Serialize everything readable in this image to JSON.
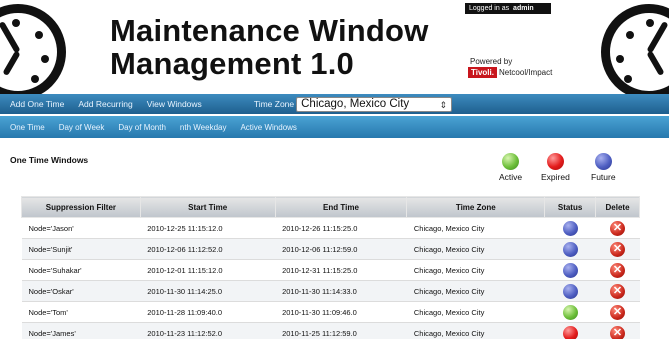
{
  "header": {
    "title_line1": "Maintenance Window",
    "title_line2": "Management 1.0",
    "logged_in_text": "Logged in as",
    "username": "admin",
    "powered_by": "Powered by",
    "brand": "Tivoli.",
    "product": "Netcool/Impact"
  },
  "nav_primary": {
    "items": [
      "Add One Time",
      "Add Recurring",
      "View Windows"
    ],
    "timezone_label": "Time Zone",
    "timezone_value": "Chicago, Mexico City"
  },
  "nav_secondary": {
    "items": [
      "One Time",
      "Day of Week",
      "Day of Month",
      "nth Weekday",
      "Active Windows"
    ]
  },
  "section": {
    "title": "One Time Windows"
  },
  "legend": [
    {
      "label": "Active",
      "color": "#6dbf3a"
    },
    {
      "label": "Expired",
      "color": "#e31b1b"
    },
    {
      "label": "Future",
      "color": "#4f5fc2"
    }
  ],
  "table": {
    "columns": [
      "Suppression Filter",
      "Start Time",
      "End Time",
      "Time Zone",
      "Status",
      "Delete"
    ],
    "rows": [
      {
        "filter": "Node='Jason'",
        "start": "2010-12-25 11:15:12.0",
        "end": "2010-12-26 11:15:25.0",
        "tz": "Chicago, Mexico City",
        "status": "future"
      },
      {
        "filter": "Node='Sunjit'",
        "start": "2010-12-06 11:12:52.0",
        "end": "2010-12-06 11:12:59.0",
        "tz": "Chicago, Mexico City",
        "status": "future"
      },
      {
        "filter": "Node='Suhakar'",
        "start": "2010-12-01 11:15:12.0",
        "end": "2010-12-31 11:15:25.0",
        "tz": "Chicago, Mexico City",
        "status": "future"
      },
      {
        "filter": "Node='Oskar'",
        "start": "2010-11-30 11:14:25.0",
        "end": "2010-11-30 11:14:33.0",
        "tz": "Chicago, Mexico City",
        "status": "future"
      },
      {
        "filter": "Node='Tom'",
        "start": "2010-11-28 11:09:40.0",
        "end": "2010-11-30 11:09:46.0",
        "tz": "Chicago, Mexico City",
        "status": "active"
      },
      {
        "filter": "Node='James'",
        "start": "2010-11-23 11:12:52.0",
        "end": "2010-11-25 11:12:59.0",
        "tz": "Chicago, Mexico City",
        "status": "expired"
      }
    ],
    "delete_icon": "delete-x-icon"
  }
}
